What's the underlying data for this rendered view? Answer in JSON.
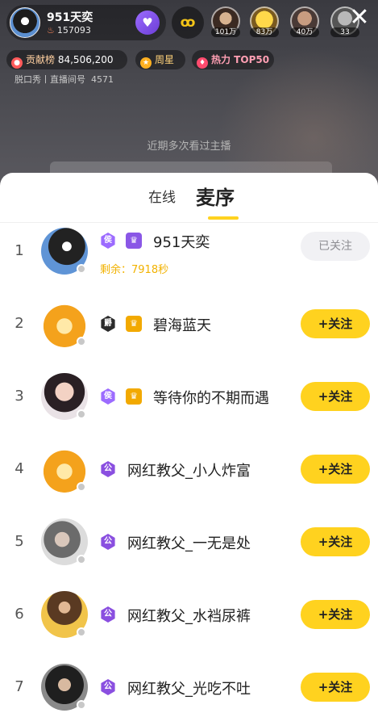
{
  "header": {
    "anchor_name": "951天奕",
    "anchor_id": "157093",
    "viewers": [
      {
        "count": "101万"
      },
      {
        "count": "83万"
      },
      {
        "count": "40万"
      },
      {
        "count": "33"
      }
    ],
    "contribution_label": "贡献榜",
    "contribution_value": "84,506,200",
    "weekly_star_label": "周星",
    "hot_label": "热力 TOP50",
    "room_sub": "脱口秀丨直播间号",
    "room_number": "4571"
  },
  "recent_hint": "近期多次看过主播",
  "tabs": {
    "online": "在线",
    "queue": "麦序"
  },
  "queue": [
    {
      "num": "1",
      "name": "951天奕",
      "remain": "剩余：7918秒",
      "action": "已关注",
      "followed": true,
      "lvl": "侯",
      "lvl_color": "#9c6bff",
      "shirt_color": "#8a57e6"
    },
    {
      "num": "2",
      "name": "碧海蓝天",
      "action": "+关注",
      "followed": false,
      "lvl": "爵",
      "lvl_color": "#2b2b2b",
      "shirt_color": "#f2a900"
    },
    {
      "num": "3",
      "name": "等待你的不期而遇",
      "action": "+关注",
      "followed": false,
      "lvl": "侯",
      "lvl_color": "#9c6bff",
      "shirt_color": "#f2a900"
    },
    {
      "num": "4",
      "name": "网红教父_小人炸富",
      "action": "+关注",
      "followed": false,
      "lvl": "公",
      "lvl_color": "#8a4fe0"
    },
    {
      "num": "5",
      "name": "网红教父_一无是处",
      "action": "+关注",
      "followed": false,
      "lvl": "公",
      "lvl_color": "#8a4fe0"
    },
    {
      "num": "6",
      "name": "网红教父_水裆尿裤",
      "action": "+关注",
      "followed": false,
      "lvl": "公",
      "lvl_color": "#8a4fe0"
    },
    {
      "num": "7",
      "name": "网红教父_光吃不吐",
      "action": "+关注",
      "followed": false,
      "lvl": "公",
      "lvl_color": "#8a4fe0"
    }
  ],
  "colors": {
    "accent_yellow": "#ffd21f",
    "remain_text": "#f2b200"
  }
}
